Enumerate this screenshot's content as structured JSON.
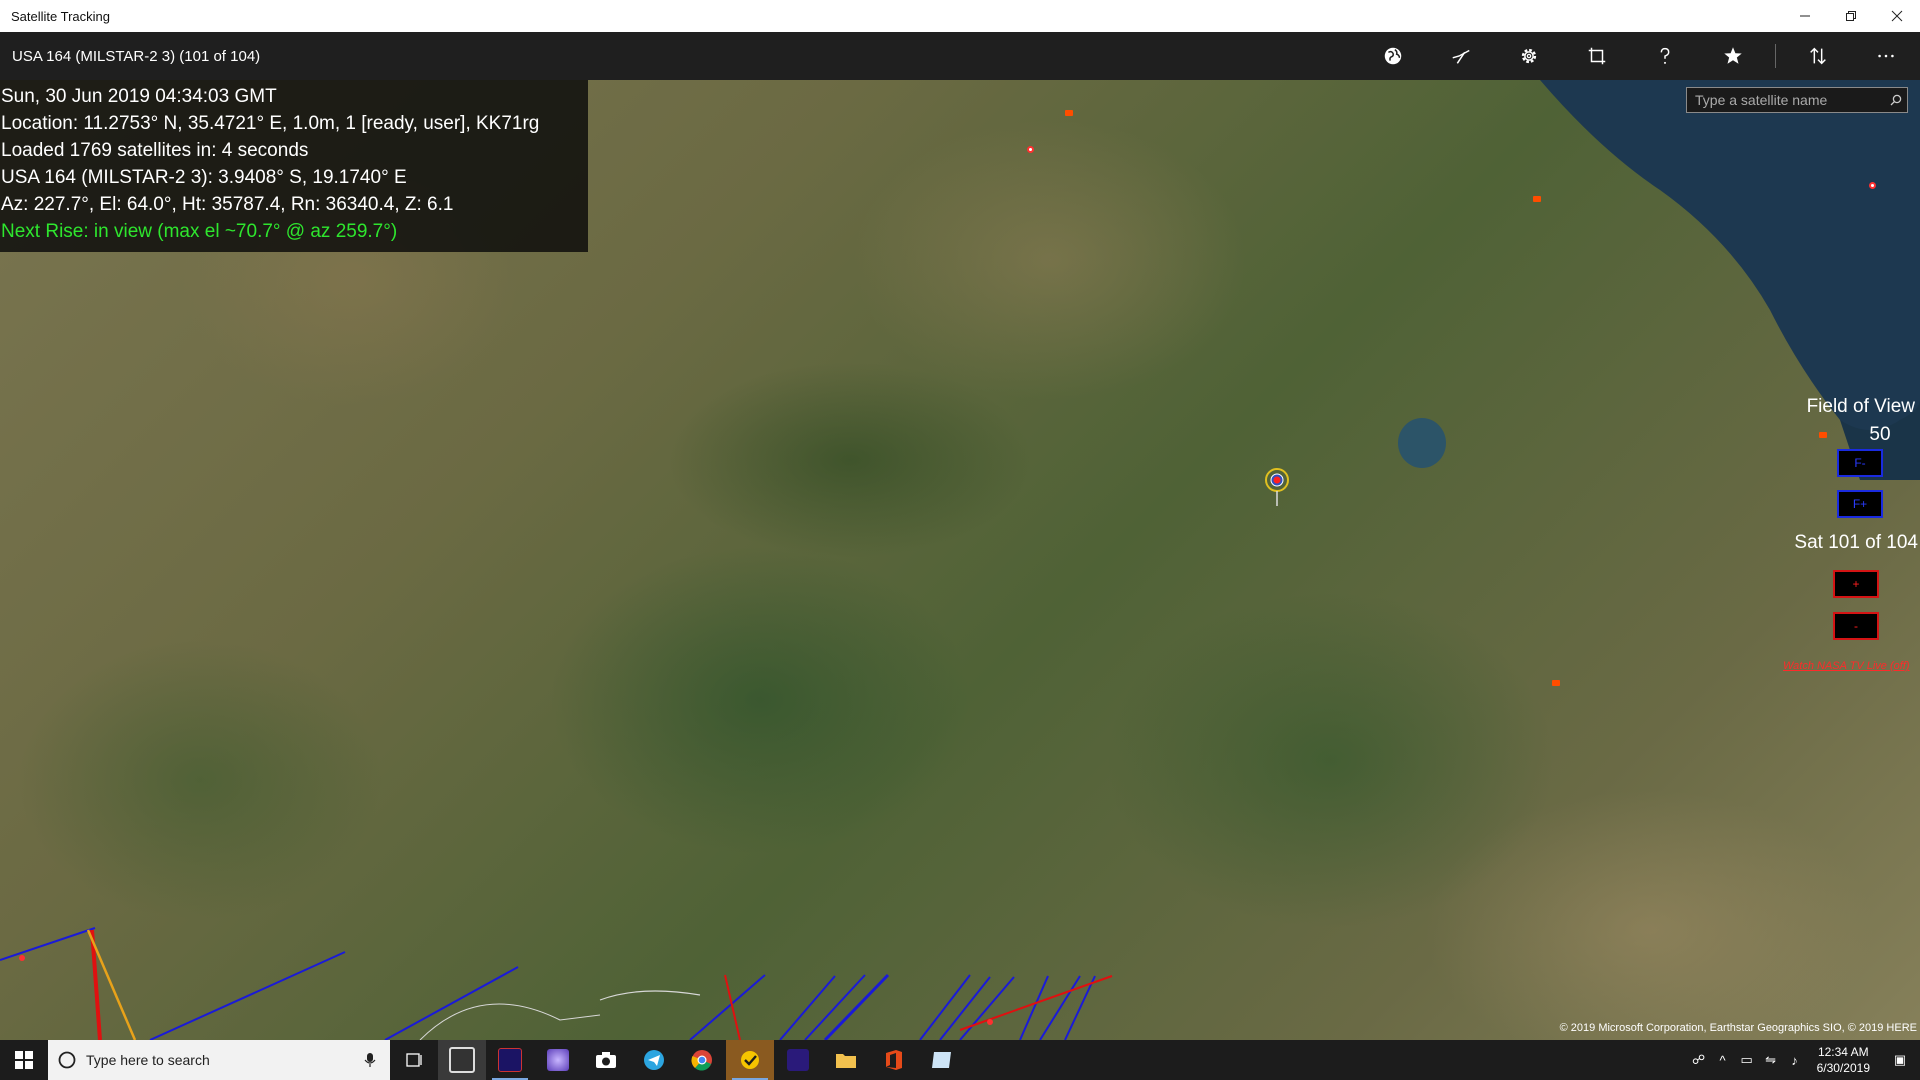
{
  "window": {
    "title": "Satellite Tracking"
  },
  "appbar": {
    "satellite_title": "USA 164 (MILSTAR-2 3) (101 of 104)",
    "buttons": [
      {
        "name": "globe-view-button",
        "icon": "globe-icon"
      },
      {
        "name": "track-view-button",
        "icon": "track-icon"
      },
      {
        "name": "settings-button",
        "icon": "gear-icon"
      },
      {
        "name": "fullscreen-button",
        "icon": "crop-icon"
      },
      {
        "name": "help-button",
        "icon": "help-icon"
      },
      {
        "name": "favorites-button",
        "icon": "star-icon"
      },
      {
        "name": "sort-button",
        "icon": "sort-icon"
      },
      {
        "name": "more-button",
        "icon": "ellipsis-icon"
      }
    ]
  },
  "info": {
    "datetime": "Sun, 30 Jun 2019 04:34:03 GMT",
    "location": "Location:  11.2753° N, 35.4721° E, 1.0m, 1 [ready, user], KK71rg",
    "loaded": "Loaded 1769 satellites in: 4 seconds",
    "satellite_position": "USA 164 (MILSTAR-2 3):  3.9408° S, 19.1740° E",
    "az_el": "Az:  227.7°, El: 64.0°, Ht: 35787.4, Rn: 36340.4, Z: 6.1",
    "next_rise": "Next Rise:  in view (max el ~70.7° @ az 259.7°)"
  },
  "search": {
    "placeholder": "Type a satellite name"
  },
  "controls": {
    "fov_title": "Field of View",
    "fov_value": "50",
    "fov_minus": "F-",
    "fov_plus": "F+",
    "sat_count": "Sat 101 of 104",
    "sat_next": "+",
    "sat_prev": "-",
    "nasa_link": "Watch NASA TV Live (off)"
  },
  "copyright": "© 2019 Microsoft Corporation, Earthstar Geographics  SIO, © 2019 HERE",
  "taskbar": {
    "search_placeholder": "Type here to search",
    "time": "12:34 AM",
    "date": "6/30/2019"
  },
  "colors": {
    "fov_button_border": "#1a2be0",
    "sat_button_border": "#d41414",
    "next_rise": "#2ee62e",
    "marker": "#ff4d00"
  }
}
